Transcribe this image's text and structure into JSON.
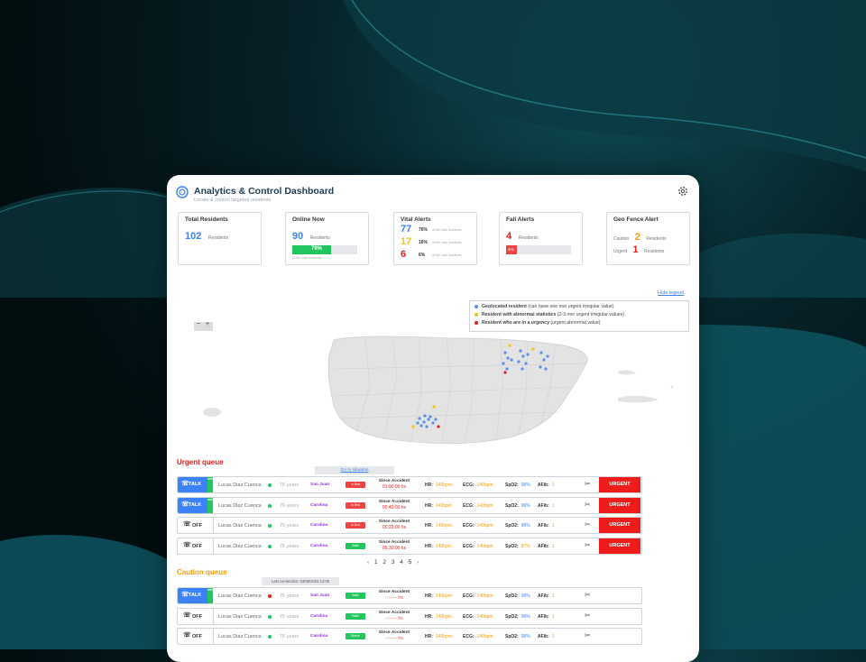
{
  "app": {
    "title": "Analytics & Control Dashboard",
    "subtitle": "Locate & control targeted residents"
  },
  "colors": {
    "blue": "#3b82f6",
    "red": "#ef1c1c",
    "orange": "#f59e0b",
    "yellow": "#f5c518",
    "green": "#22c55e",
    "purple": "#9333ea"
  },
  "stats": {
    "total": {
      "label": "Total Residents",
      "value": "102",
      "unit": "Residents"
    },
    "online": {
      "label": "Online Now",
      "value": "90",
      "unit": "Residents",
      "progress_label": "79%",
      "progress": 0.79,
      "note": "of the total residents"
    },
    "vital": {
      "label": "Vital Alerts",
      "rows": [
        {
          "value": "77",
          "pct": "76%",
          "note": "of the total residents"
        },
        {
          "value": "17",
          "pct": "16%",
          "note": "of the total residents"
        },
        {
          "value": "6",
          "pct": "6%",
          "note": "of the total residents"
        }
      ]
    },
    "fall": {
      "label": "Fall Alerts",
      "value": "4",
      "unit": "Residents",
      "progress_label": "4%",
      "progress": 0.04
    },
    "geo": {
      "label": "Geo Fence Alert",
      "caution_label": "Caution",
      "caution_value": "2",
      "caution_unit": "Residents",
      "urgent_label": "Urgent",
      "urgent_value": "1",
      "urgent_unit": "Residents"
    }
  },
  "map": {
    "hide_legend": "Hide legend",
    "legend": [
      {
        "bold": "Geolocated resident",
        "rest": " (can have one non urgent irregular value)",
        "color": "#5b8def"
      },
      {
        "bold": "Resident with abnormal statistics",
        "rest": " (2-3 non urgent irregular values)",
        "color": "#f5c518"
      },
      {
        "bold": "Resident who are in a urgency",
        "rest": " (urgent abnormal value)",
        "color": "#e11d1d"
      }
    ],
    "zoom_out": "−",
    "zoom_in": "+"
  },
  "urgent_queue": {
    "title": "Urgent queue",
    "tooltip": "Go to situation",
    "rows": [
      {
        "mode": "TALK",
        "name": "Lucas Diaz Cuenca",
        "age": "76 years",
        "city": "San Juan",
        "badge": "In Bed",
        "since": "01:00:00 hs",
        "hr": "140bpm",
        "ecg": "140bpm",
        "spo2": "96%",
        "afib": "1",
        "spo2_color": "#3b82f6"
      },
      {
        "mode": "TALK",
        "name": "Lucas Diaz Cuenca",
        "age": "76 years",
        "city": "Carolina",
        "badge": "In Bed",
        "since": "00:40:00 hs",
        "hr": "140bpm",
        "ecg": "140bpm",
        "spo2": "96%",
        "afib": "1",
        "spo2_color": "#3b82f6"
      },
      {
        "mode": "OFF",
        "name": "Lucas Diaz Cuenca",
        "age": "76 years",
        "city": "Carolina",
        "badge": "In Bed",
        "since": "00:22:00 hs",
        "hr": "140bpm",
        "ecg": "140bpm",
        "spo2": "96%",
        "afib": "1",
        "spo2_color": "#3b82f6"
      },
      {
        "mode": "OFF",
        "name": "Lucas Diaz Cuenca",
        "age": "76 years",
        "city": "Carolina",
        "badge": "Walk",
        "since": "05:30:00 hs",
        "hr": "140bpm",
        "ecg": "140bpm",
        "spo2": "87%",
        "afib": "1",
        "spo2_color": "#f59e0b"
      }
    ],
    "urgent_label": "URGENT",
    "side_label": "SOS"
  },
  "pager": {
    "pages": [
      "1",
      "2",
      "3",
      "4",
      "5"
    ],
    "prev": "‹",
    "next": "›"
  },
  "caution_queue": {
    "title": "Caution queue",
    "tooltip": "Last connection: 03/05/2024 14:00",
    "rows": [
      {
        "mode": "TALK",
        "name": "Lucas Diaz Cuenca",
        "age": "76 years",
        "city": "San Juan",
        "badge": "Walk",
        "since": "--:--:-- hs",
        "hr": "140bpm",
        "ecg": "140bpm",
        "spo2": "96%",
        "afib": "1"
      },
      {
        "mode": "OFF",
        "name": "Lucas Diaz Cuenca",
        "age": "76 years",
        "city": "Carolina",
        "badge": "Walk",
        "since": "--:--:-- hs",
        "hr": "140bpm",
        "ecg": "140bpm",
        "spo2": "96%",
        "afib": "1"
      },
      {
        "mode": "OFF",
        "name": "Lucas Diaz Cuenca",
        "age": "76 years",
        "city": "Carolina",
        "badge": "Stable",
        "since": "--:--:-- hs",
        "hr": "140bpm",
        "ecg": "140bpm",
        "spo2": "96%",
        "afib": "1"
      }
    ]
  },
  "labels": {
    "since": "Since Accident",
    "hr": "HR:",
    "ecg": "ECG:",
    "spo2": "SpO2:",
    "afib": "AFib:"
  }
}
